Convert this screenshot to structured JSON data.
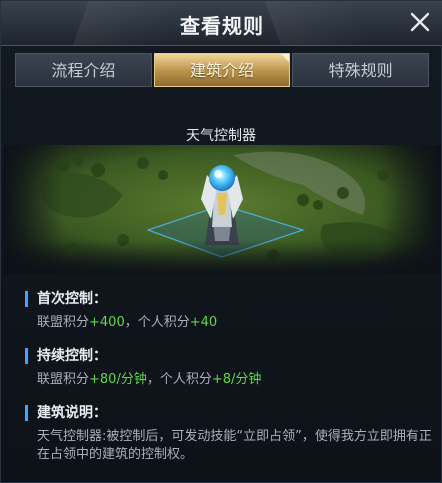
{
  "dialog": {
    "title": "查看规则"
  },
  "tabs": [
    {
      "label": "流程介绍"
    },
    {
      "label": "建筑介绍",
      "active": true
    },
    {
      "label": "特殊规则"
    }
  ],
  "building": {
    "name": "天气控制器"
  },
  "sections": {
    "first_control": {
      "heading": "首次控制：",
      "alliance_label": "联盟积分",
      "alliance_value": "+400",
      "separator": "，",
      "personal_label": "个人积分",
      "personal_value": "+40"
    },
    "continuous_control": {
      "heading": "持续控制：",
      "alliance_label": "联盟积分",
      "alliance_value": "+80/分钟",
      "separator": "，",
      "personal_label": "个人积分",
      "personal_value": "+8/分钟"
    },
    "building_desc": {
      "heading": "建筑说明：",
      "text": "天气控制器:被控制后，可发动技能“立即占领”，使得我方立即拥有正在占领中的建筑的控制权。"
    }
  },
  "colors": {
    "accent_gold": "#d9b66b",
    "score_green": "#5fd84a",
    "bar_blue": "#3fa6ff"
  }
}
